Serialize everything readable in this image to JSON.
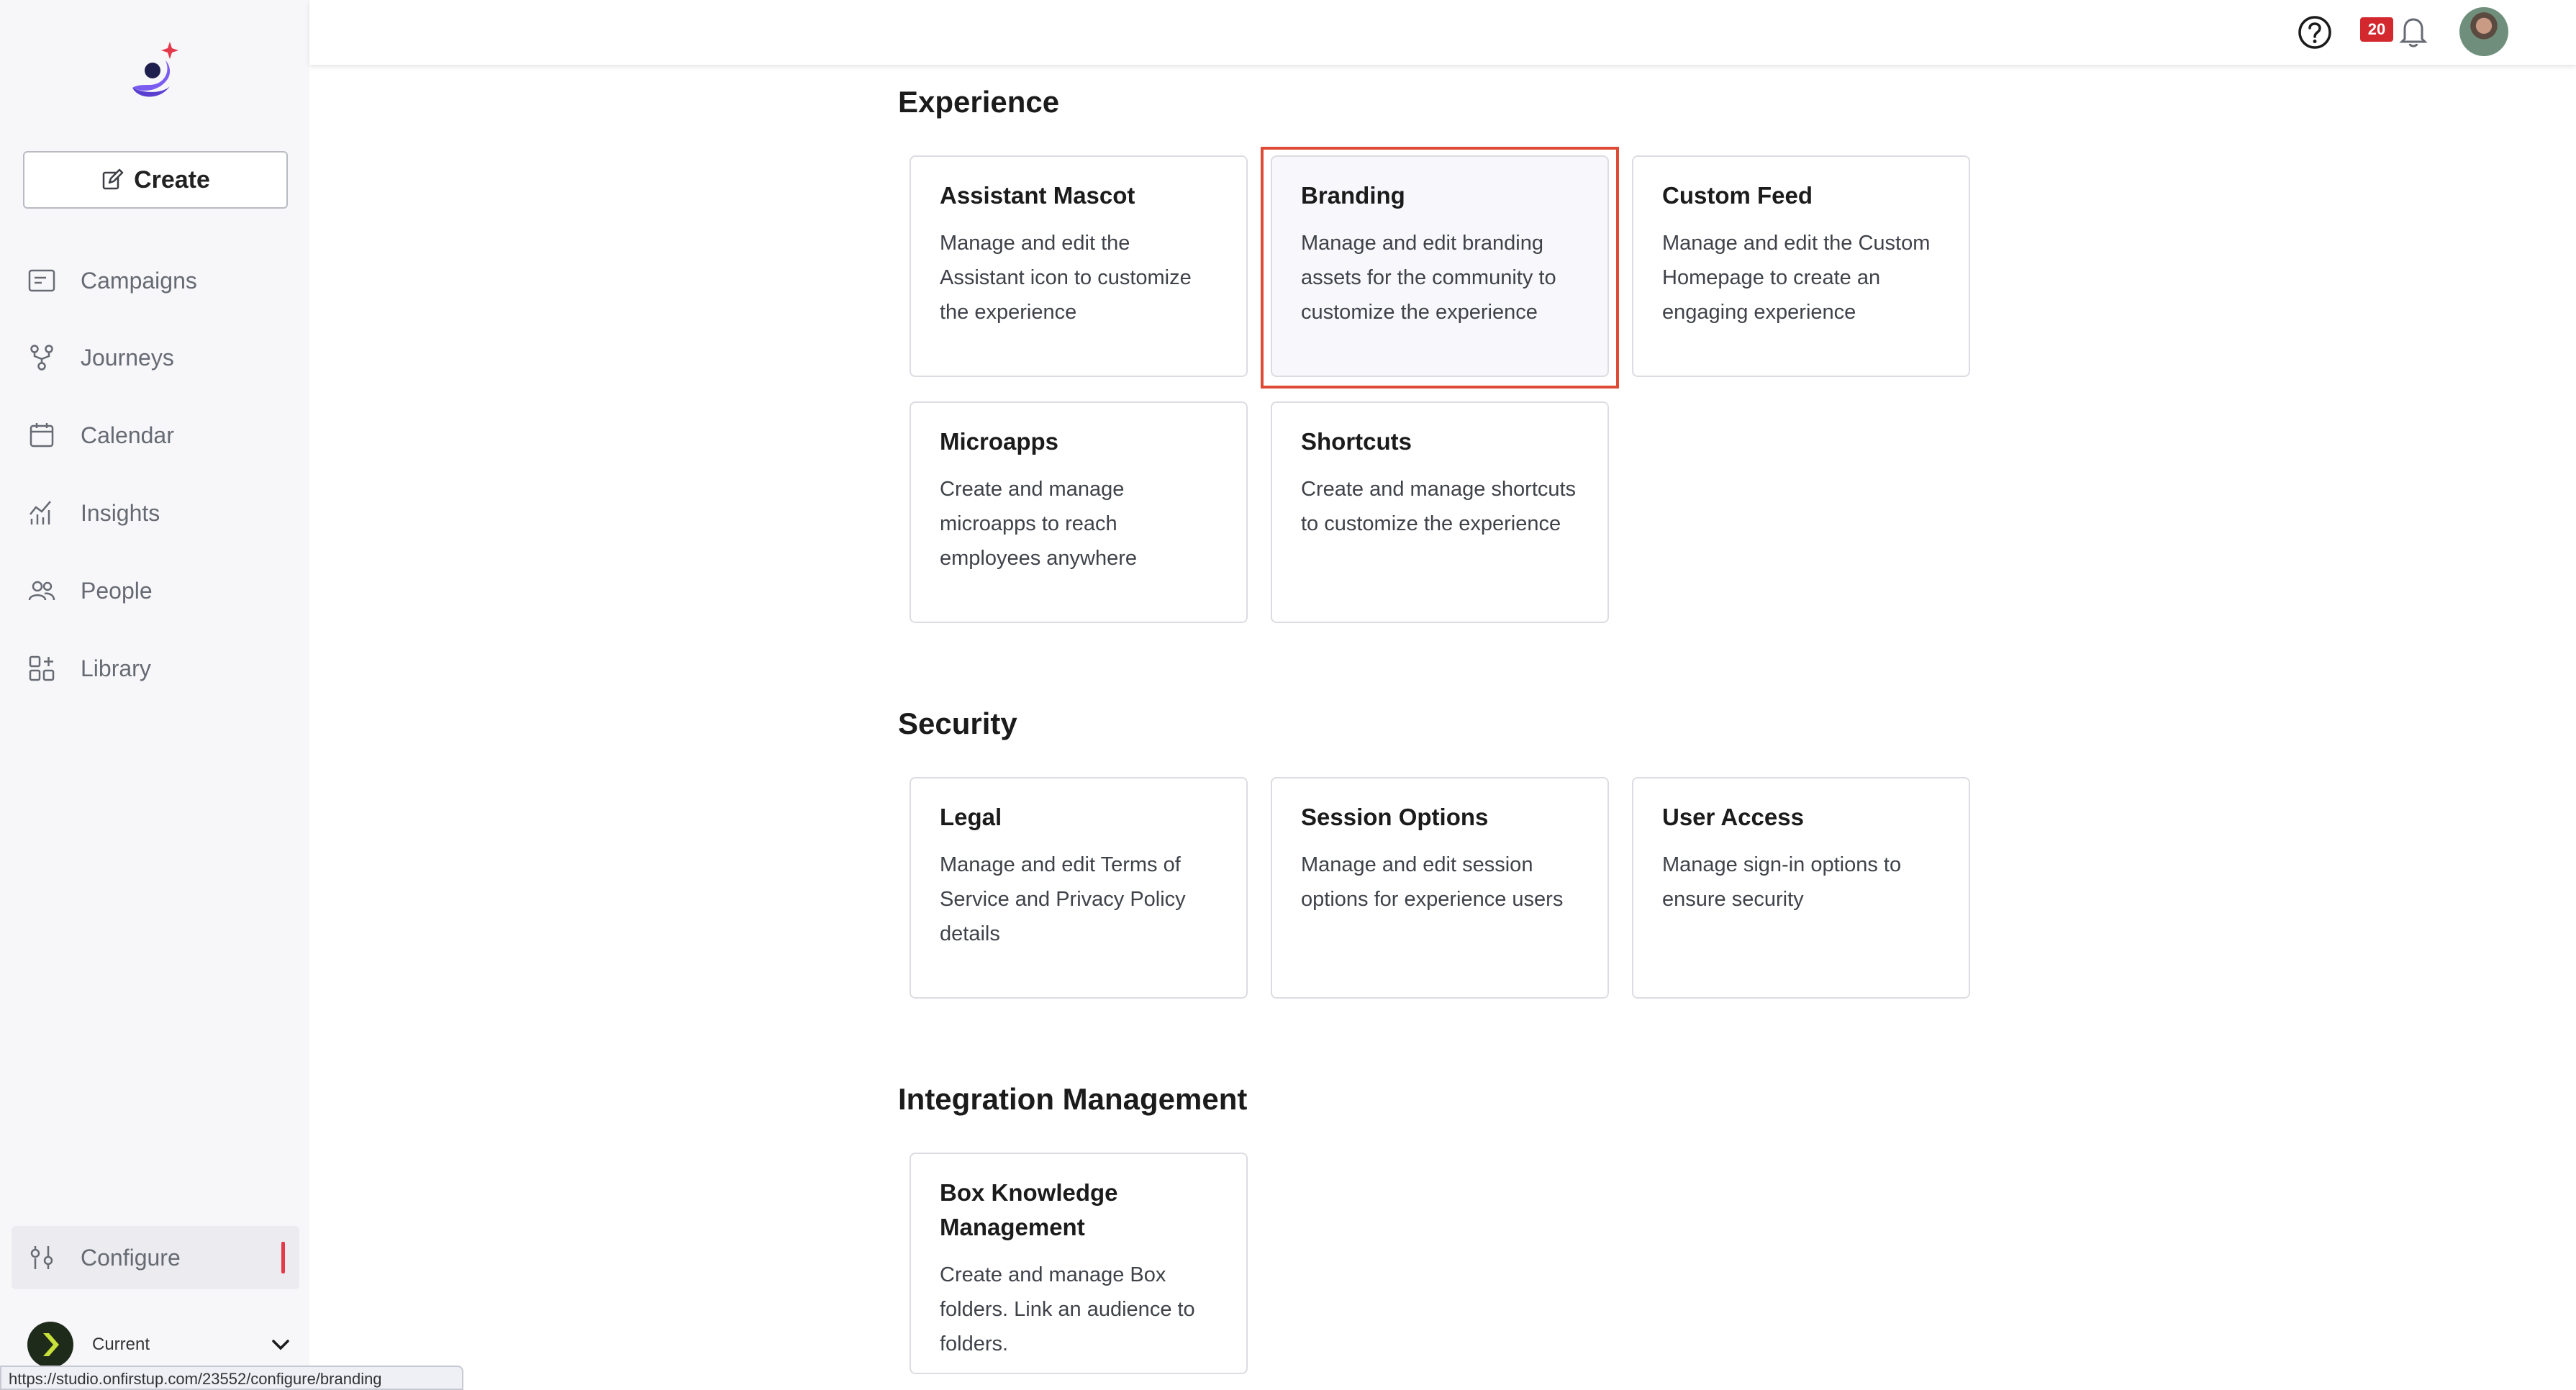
{
  "sidebar": {
    "create_label": "Create",
    "items": [
      {
        "id": "campaigns",
        "label": "Campaigns",
        "icon": "campaigns-icon"
      },
      {
        "id": "journeys",
        "label": "Journeys",
        "icon": "journeys-icon"
      },
      {
        "id": "calendar",
        "label": "Calendar",
        "icon": "calendar-icon"
      },
      {
        "id": "insights",
        "label": "Insights",
        "icon": "insights-icon"
      },
      {
        "id": "people",
        "label": "People",
        "icon": "people-icon"
      },
      {
        "id": "library",
        "label": "Library",
        "icon": "library-icon"
      }
    ],
    "configure_label": "Configure",
    "org_label": "Current"
  },
  "header": {
    "notification_count": "20"
  },
  "sections": {
    "experience": {
      "title": "Experience",
      "cards": [
        {
          "title": "Assistant Mascot",
          "desc": "Manage and edit the Assistant icon to customize the experience"
        },
        {
          "title": "Branding",
          "desc": "Manage and edit branding assets for the community to customize the experience"
        },
        {
          "title": "Custom Feed",
          "desc": "Manage and edit the Custom Homepage to create an engaging experience"
        },
        {
          "title": "Microapps",
          "desc": "Create and manage microapps to reach employees anywhere"
        },
        {
          "title": "Shortcuts",
          "desc": "Create and manage shortcuts to customize the experience"
        }
      ]
    },
    "security": {
      "title": "Security",
      "cards": [
        {
          "title": "Legal",
          "desc": "Manage and edit Terms of Service and Privacy Policy details"
        },
        {
          "title": "Session Options",
          "desc": "Manage and edit session options for experience users"
        },
        {
          "title": "User Access",
          "desc": "Manage sign-in options to ensure security"
        }
      ]
    },
    "integration": {
      "title": "Integration Management",
      "cards": [
        {
          "title": "Box Knowledge Management",
          "desc": "Create and manage Box folders. Link an audience to folders."
        }
      ]
    }
  },
  "status_url": "https://studio.onfirstup.com/23552/configure/branding",
  "colors": {
    "accent_red": "#dd4a36",
    "badge_red": "#d2282e",
    "logo_purple": "#7b5cf0"
  }
}
